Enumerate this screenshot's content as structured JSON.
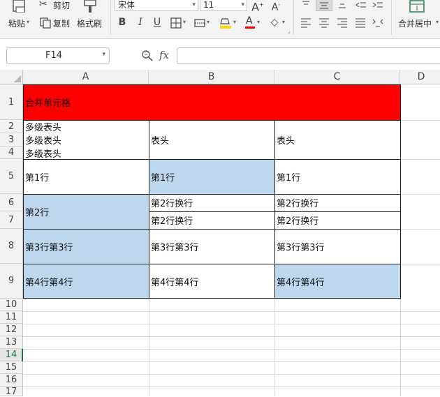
{
  "ribbon": {
    "paste_label": "粘贴",
    "cut_label": "剪切",
    "copy_label": "复制",
    "format_painter_label": "格式刷",
    "font_name": "宋体",
    "font_size": "11",
    "merge_center_label": "合并居中"
  },
  "formula_bar": {
    "name_box": "F14",
    "fx_label": "fx",
    "formula": ""
  },
  "columns": [
    "A",
    "B",
    "C",
    "D"
  ],
  "rows": [
    "1",
    "2",
    "3",
    "4",
    "5",
    "6",
    "7",
    "8",
    "9",
    "10",
    "11",
    "12",
    "13",
    "14",
    "15",
    "16",
    "17"
  ],
  "cells": {
    "a1": "合并单元格",
    "a2": "多级表头",
    "a3": "多级表头",
    "a4": "多级表头",
    "b2": "表头",
    "c2": "表头",
    "a5": "第1行",
    "b5": "第1行",
    "c5": "第1行",
    "a6": "第2行",
    "b6": "第2行换行",
    "b7": "第2行换行",
    "c6": "第2行换行",
    "c7": "第2行换行",
    "a8": "第3行第3行",
    "b8": "第3行第3行",
    "c8": "第3行第3行",
    "a9": "第4行第4行",
    "b9": "第4行第4行",
    "c9": "第4行第4行"
  },
  "colors": {
    "merged_header_fill": "#ff0000",
    "highlight_fill": "#bdd7ee",
    "active_row_color": "#217346"
  }
}
